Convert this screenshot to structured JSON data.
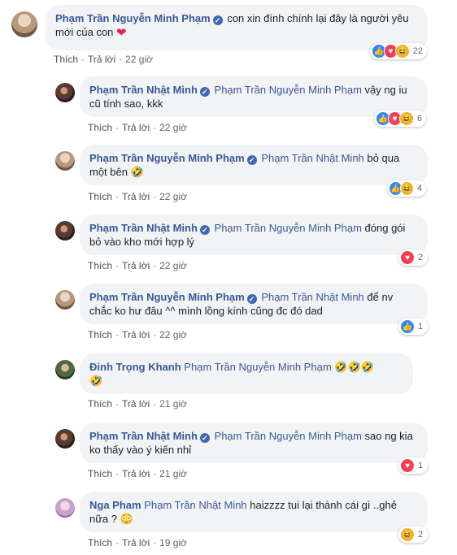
{
  "actions": {
    "like": "Thích",
    "reply": "Trả lời"
  },
  "comments": [
    {
      "author": "Phạm Trần Nguyễn Minh Phạm",
      "tag": "",
      "text": "con xin đính chính lại đây là người yêu mới của con",
      "time": "22 giờ",
      "reaction_count": "22",
      "reactions": [
        "like",
        "love",
        "haha"
      ]
    },
    {
      "author": "Phạm Trần Nhật Minh",
      "tag": "Phạm Trần Nguyễn Minh Phạm",
      "text": "vậy ng iu cũ tính sao, kkk",
      "time": "22 giờ",
      "reaction_count": "6",
      "reactions": [
        "like",
        "love",
        "haha"
      ]
    },
    {
      "author": "Phạm Trần Nguyễn Minh Phạm",
      "tag": "Phạm Trần Nhật Minh",
      "text": "bỏ qua một bên",
      "time": "22 giờ",
      "reaction_count": "4",
      "reactions": [
        "like",
        "haha"
      ]
    },
    {
      "author": "Phạm Trần Nhật Minh",
      "tag": "Phạm Trần Nguyễn Minh Phạm",
      "text": "đóng gói bỏ vào kho mới hợp lý",
      "time": "22 giờ",
      "reaction_count": "2",
      "reactions": [
        "love"
      ]
    },
    {
      "author": "Phạm Trần Nguyễn Minh Phạm",
      "tag": "Phạm Trần Nhật Minh",
      "text": "để nv chắc ko hư đâu ^^ mình lồng kính cũng đc đó dad",
      "time": "22 giờ",
      "reaction_count": "1",
      "reactions": [
        "like"
      ]
    },
    {
      "author": "Đinh Trọng Khanh",
      "tag": "Phạm Trần Nguyễn Minh Phạm",
      "text": "",
      "time": "21 giờ",
      "reaction_count": "",
      "reactions": []
    },
    {
      "author": "Phạm Trần Nhật Minh",
      "tag": "Phạm Trần Nguyễn Minh Phạm",
      "text": "sao ng kia ko thấy vào ý kiến nhỉ",
      "time": "21 giờ",
      "reaction_count": "1",
      "reactions": [
        "love"
      ]
    },
    {
      "author": "Nga Pham",
      "tag": "Phạm Trần Nhật Minh",
      "text": "haizzzz tui lại thành cái gì ..ghẻ nữa ?",
      "time": "19 giờ",
      "reaction_count": "2",
      "reactions": [
        "haha"
      ]
    }
  ]
}
